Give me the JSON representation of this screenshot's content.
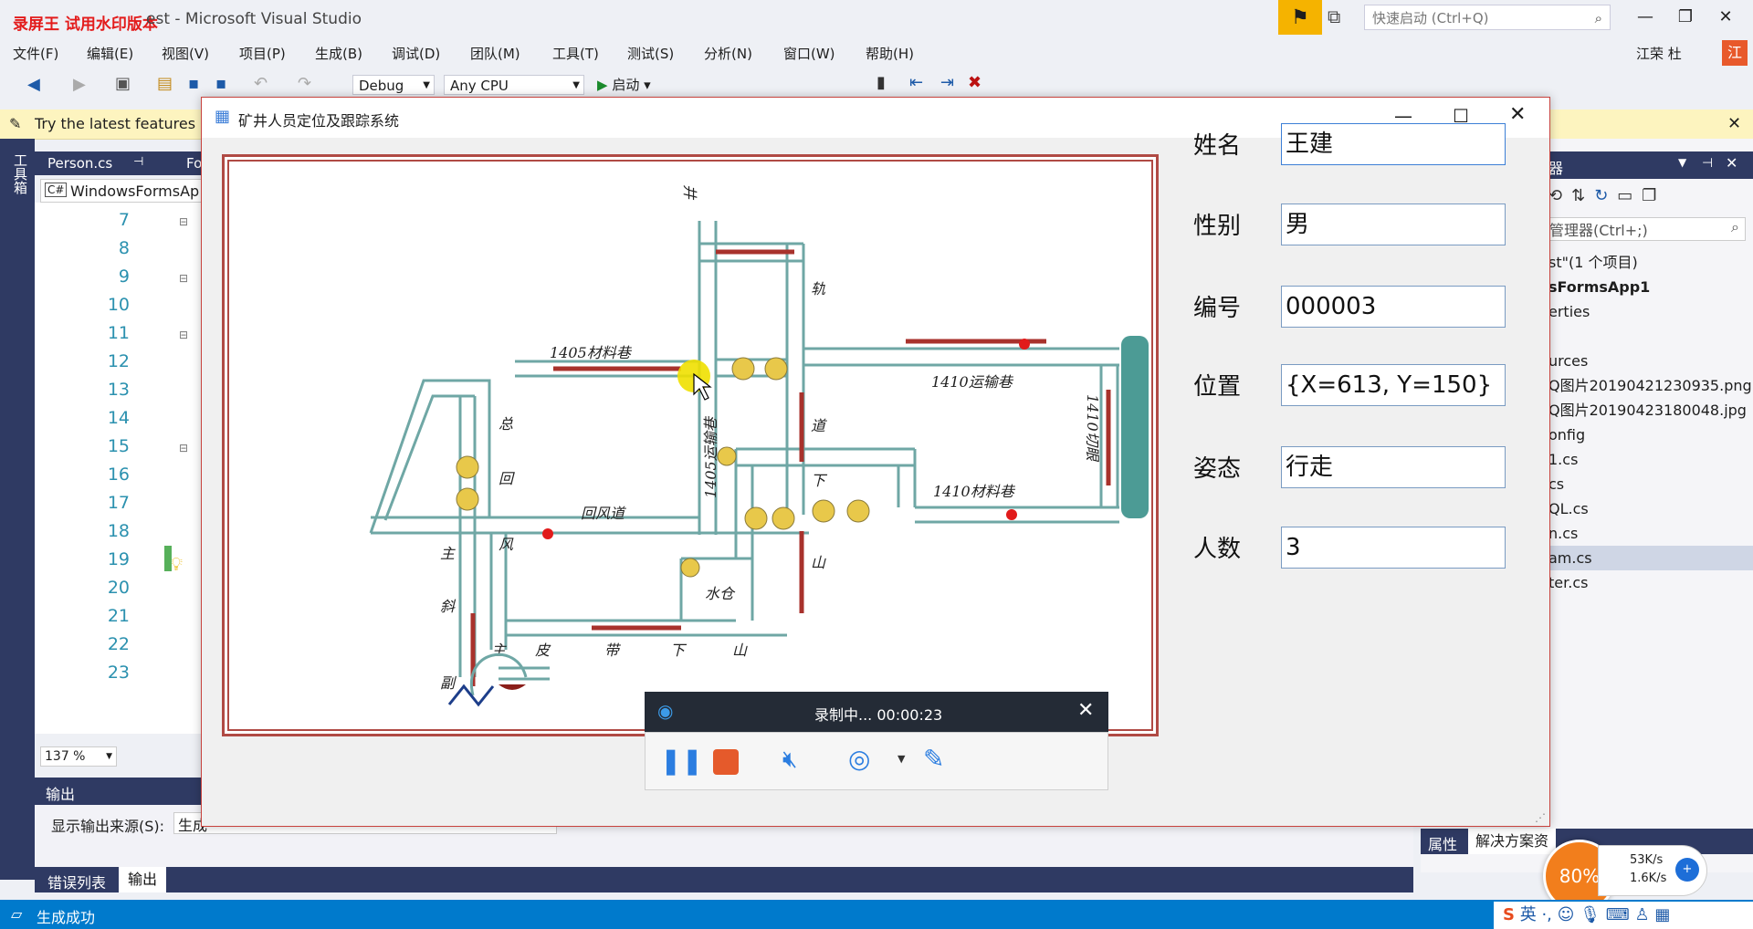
{
  "vs": {
    "watermark": "录屏王 试用水印版本",
    "title": "est - Microsoft Visual Studio",
    "quick_launch_placeholder": "快速启动 (Ctrl+Q)",
    "user": "江荣 杜",
    "user_avatar": "江",
    "menus": [
      "文件(F)",
      "编辑(E)",
      "视图(V)",
      "项目(P)",
      "生成(B)",
      "调试(D)",
      "团队(M)",
      "工具(T)",
      "测试(S)",
      "分析(N)",
      "窗口(W)",
      "帮助(H)"
    ],
    "config": "Debug",
    "platform": "Any CPU",
    "start_label": "启动",
    "infobar_text": "Try the latest features",
    "toolbox_label": "工具箱",
    "editor_tab": "Person.cs",
    "editor_tab2": "Fo",
    "editor_nav": "WindowsFormsAp",
    "line_numbers": [
      "7",
      "8",
      "9",
      "10",
      "11",
      "12",
      "13",
      "14",
      "15",
      "16",
      "17",
      "18",
      "19",
      "20",
      "21",
      "22",
      "23"
    ],
    "zoom": "137 %",
    "output_title": "输出",
    "output_source_label": "显示输出来源(S):",
    "output_source_value": "生成",
    "bottom_tabs": [
      "错误列表",
      "输出"
    ],
    "status": "生成成功",
    "right_panel_title": "器",
    "right_search_placeholder": "管理器(Ctrl+;)",
    "solution_items": [
      "st\"(1 个项目)",
      "sFormsApp1",
      "erties",
      "",
      "urces",
      "Q图片20190421230935.png",
      "Q图片20190423180048.jpg",
      "onfig",
      "1.cs",
      "cs",
      "QL.cs",
      "n.cs",
      "am.cs",
      "ter.cs"
    ],
    "right_bottom_tabs": [
      "属性",
      "解决方案资"
    ],
    "net_percent": "80%",
    "net_up": "53K/s",
    "net_down": "1.6K/s",
    "ime": "英"
  },
  "form": {
    "title": "矿井人员定位及跟踪系统",
    "fields": [
      {
        "label": "姓名",
        "value": "王建"
      },
      {
        "label": "性别",
        "value": "男"
      },
      {
        "label": "编号",
        "value": "000003"
      },
      {
        "label": "位置",
        "value": "{X=613, Y=150}"
      },
      {
        "label": "姿态",
        "value": "行走"
      },
      {
        "label": "人数",
        "value": "3"
      }
    ],
    "map_labels": {
      "l1": "1405材料巷",
      "l2": "1410运输巷",
      "l3": "1410材料巷",
      "l4": "回风道",
      "l5": "1410切眼",
      "l6": "1405运输巷",
      "l7": "水仓",
      "c1": "总",
      "c2": "回",
      "c3": "风",
      "c4": "主",
      "c5": "斜",
      "c6": "主",
      "c7": "皮",
      "c8": "带",
      "c9": "下",
      "c10": "山",
      "c11": "下",
      "c12": "山",
      "c13": "轨",
      "c14": "道",
      "c15": "副",
      "c16": "井"
    }
  },
  "recorder": {
    "status": "录制中... 00:00:23"
  },
  "colors": {
    "accent": "#007acc",
    "rec_head": "#242b36",
    "stop": "#e55a2b",
    "tunnel": "#6fa7a5",
    "arrow": "#a8322c"
  }
}
